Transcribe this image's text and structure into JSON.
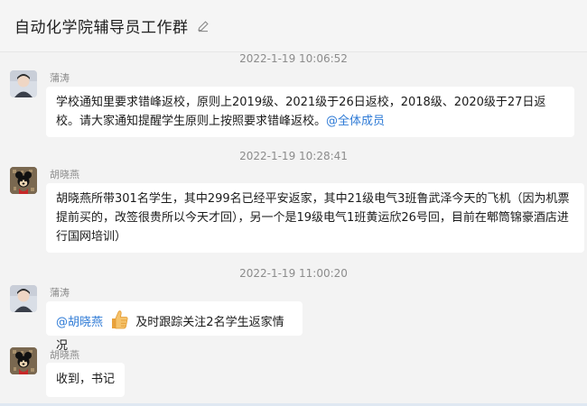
{
  "header": {
    "title": "自动化学院辅导员工作群",
    "edit_icon": "pencil-icon"
  },
  "messages": [
    {
      "timestamp": "2022-1-19 10:06:52",
      "sender": "蒲涛",
      "text": "学校通知里要求错峰返校，原则上2019级、2021级于26日返校，2018级、2020级于27日返校。请大家通知提醒学生原则上按照要求错峰返校。",
      "mention": "@全体成员"
    },
    {
      "timestamp": "2022-1-19 10:28:41",
      "sender": "胡晓燕",
      "text": "胡晓燕所带301名学生，其中299名已经平安返家，其中21级电气3班鲁武泽今天的飞机（因为机票提前买的，改签很贵所以今天才回），另一个是19级电气1班黄运欣26号回，目前在郫筒锦豪酒店进行国网培训）"
    },
    {
      "timestamp": "2022-1-19 11:00:20",
      "sender": "蒲涛",
      "mention": "@胡晓燕",
      "emoji": "thumbs-up-icon",
      "text": "及时跟踪关注2名学生返家情况"
    },
    {
      "sender": "胡晓燕",
      "text": "收到，书记"
    }
  ],
  "colors": {
    "mention": "#2f7bd6",
    "background": "#f3f3f3",
    "bubble": "#ffffff"
  }
}
